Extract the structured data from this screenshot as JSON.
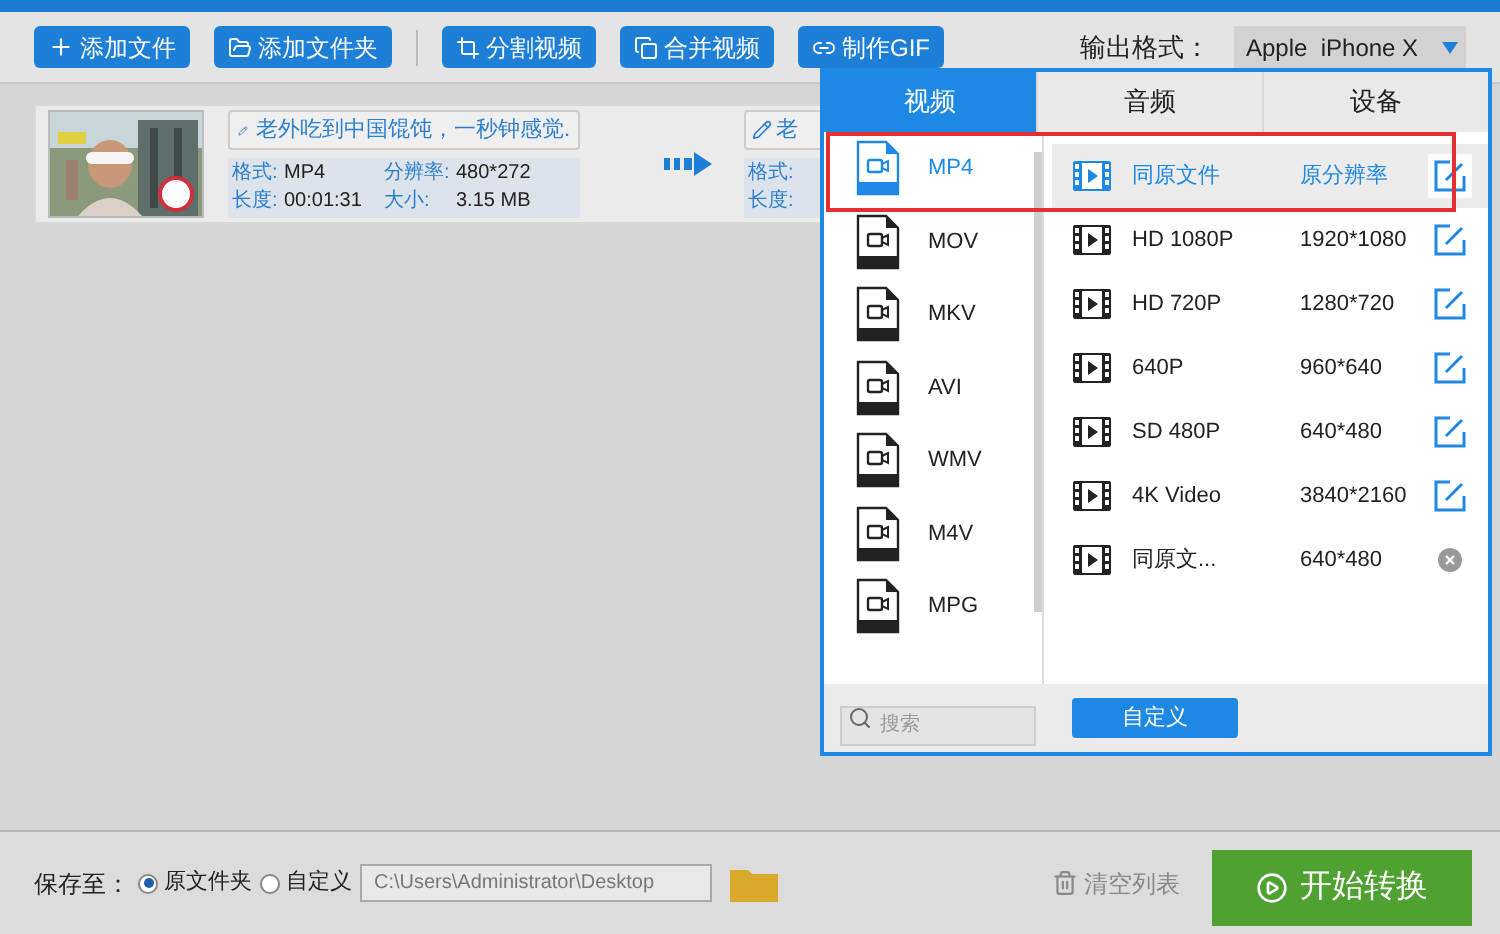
{
  "toolbar": {
    "buttons": [
      {
        "label": "添加文件",
        "kind": "plus"
      },
      {
        "label": "添加文件夹",
        "kind": "folder"
      },
      {
        "label": "分割视频",
        "kind": "crop"
      },
      {
        "label": "合并视频",
        "kind": "merge"
      },
      {
        "label": "制作GIF",
        "kind": "gif"
      }
    ],
    "output_format": {
      "label": "输出格式：",
      "value": "Apple  iPhone X"
    }
  },
  "files": [
    {
      "title": "老外吃到中国馄饨，一秒钟感觉.",
      "format_label": "格式:",
      "format": "MP4",
      "resolution_label": "分辨率:",
      "resolution": "480*272",
      "duration_label": "长度:",
      "duration": "00:01:31",
      "size_label": "大小:",
      "size": "3.15 MB",
      "output": {
        "title": "老",
        "format_label": "格式:",
        "duration_label": "长度:"
      }
    }
  ],
  "popup": {
    "tabs": [
      {
        "label": "视频",
        "selected": true
      },
      {
        "label": "音频",
        "selected": false
      },
      {
        "label": "设备",
        "selected": false
      }
    ],
    "formats": [
      {
        "label": "MP4",
        "selected": true
      },
      {
        "label": "MOV",
        "selected": false
      },
      {
        "label": "MKV",
        "selected": false
      },
      {
        "label": "AVI",
        "selected": false
      },
      {
        "label": "WMV",
        "selected": false
      },
      {
        "label": "M4V",
        "selected": false
      },
      {
        "label": "MPG",
        "selected": false
      }
    ],
    "presets": [
      {
        "name": "同原文件",
        "resolution": "原分辨率",
        "kind": "edit",
        "selected": true
      },
      {
        "name": "HD 1080P",
        "resolution": "1920*1080",
        "kind": "edit",
        "selected": false
      },
      {
        "name": "HD 720P",
        "resolution": "1280*720",
        "kind": "edit",
        "selected": false
      },
      {
        "name": "640P",
        "resolution": "960*640",
        "kind": "edit",
        "selected": false
      },
      {
        "name": "SD 480P",
        "resolution": "640*480",
        "kind": "edit",
        "selected": false
      },
      {
        "name": "4K Video",
        "resolution": "3840*2160",
        "kind": "edit",
        "selected": false
      },
      {
        "name": "同原文...",
        "resolution": "640*480",
        "kind": "delete",
        "selected": false
      }
    ],
    "search": {
      "placeholder": "搜索"
    },
    "custom_button": "自定义"
  },
  "bottom": {
    "save_label": "保存至：",
    "radios": [
      {
        "label": "原文件夹",
        "selected": true
      },
      {
        "label": "自定义",
        "selected": false
      }
    ],
    "path": "C:\\Users\\Administrator\\Desktop",
    "clear": "清空列表",
    "start": "开始转换"
  }
}
